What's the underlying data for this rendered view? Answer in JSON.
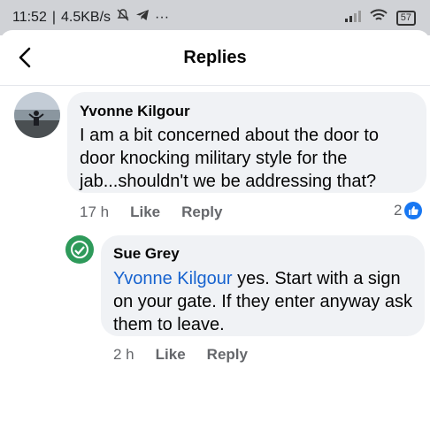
{
  "status_bar": {
    "time": "11:52",
    "speed": "4.5KB/s",
    "dots": "···",
    "battery": "57"
  },
  "header": {
    "title": "Replies"
  },
  "comment": {
    "author": "Yvonne Kilgour",
    "lines": [
      "I am a bit concerned about the door to",
      "door knocking military style for the",
      "jab...shouldn't we be addressing that?"
    ],
    "time": "17 h",
    "like_label": "Like",
    "reply_label": "Reply",
    "reaction_count": "2"
  },
  "reply": {
    "author": "Sue Grey",
    "mention": "Yvonne Kilgour",
    "line1_rest": " yes. Start with a sign",
    "lines": [
      "on your gate. If they enter anyway ask",
      "them to leave."
    ],
    "time": "2 h",
    "like_label": "Like",
    "reply_label": "Reply"
  },
  "colors": {
    "accent": "#1877f2",
    "mention": "#1763cf",
    "bubble": "#f0f2f5",
    "meta": "#65676b"
  }
}
